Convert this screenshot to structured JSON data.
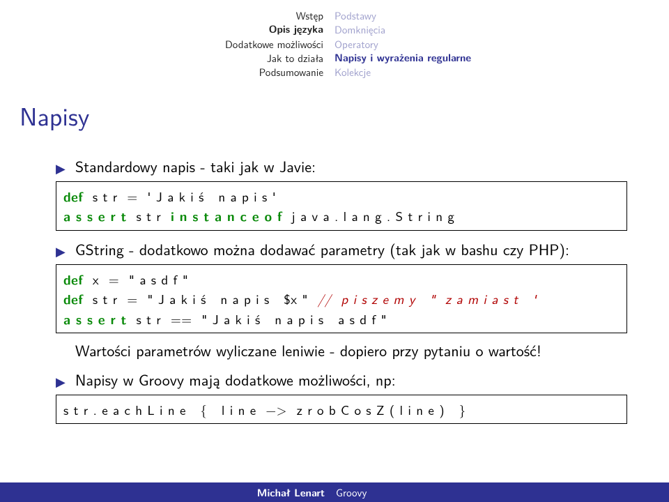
{
  "header": {
    "left": [
      "Wstęp",
      "Opis języka",
      "Dodatkowe możliwości",
      "Jak to działa",
      "Podsumowanie"
    ],
    "left_bold_index": 1,
    "right": [
      "Podstawy",
      "Domknięcia",
      "Operatory",
      "Napisy i wyrażenia regularne",
      "Kolekcje"
    ],
    "right_active_index": 3
  },
  "title": "Napisy",
  "bullets": {
    "b1": "Standardowy napis - taki jak w Javie:",
    "b2": "GString - dodatkowo można dodawać parametry (tak jak w bashu czy PHP):",
    "b3": "Wartości parametrów wyliczane leniwie - dopiero przy pytaniu o wartość!",
    "b4": "Napisy w Groovy mają dodatkowe możliwości, np:"
  },
  "code1": {
    "l1a": "def",
    "l1b": "  s t r  =  ' J a k i ś   n a p i s '",
    "l2a": "a s s e r t",
    "l2b": "  s t r  ",
    "l2c": "i n s t a n c e o f",
    "l2d": "  j a v a . l a n g . S t r i n g"
  },
  "code2": {
    "l1a": "def",
    "l1b": "  x  =  \" a s d f \"",
    "l2a": "def",
    "l2b": "  s t r  =  \" J a k i ś   n a p i s   $x \"  ",
    "l2c": "//  p i s z e m y   \"  z a m i a s t   '",
    "l3a": "a s s e r t",
    "l3b": "  s t r  ==  \" J a k i ś   n a p i s   a s d f \""
  },
  "code3": {
    "l1": "s t r . e a c h L i n e   {   l i n e  −>  z r o b C o s Z ( l i n e )   }"
  },
  "footer": {
    "author": "Michał Lenart",
    "topic": "Groovy"
  }
}
